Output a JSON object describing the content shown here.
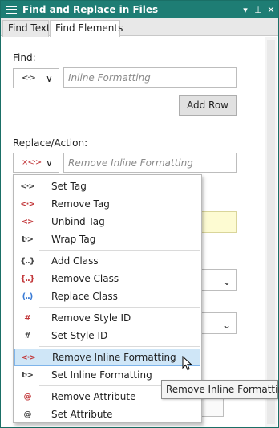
{
  "titlebar": {
    "title": "Find and Replace in Files",
    "dropdown_glyph": "▾",
    "pin_glyph": "⊥",
    "close_glyph": "✕"
  },
  "tabs": [
    {
      "label": "Find Text",
      "active": false
    },
    {
      "label": "Find Elements",
      "active": true
    }
  ],
  "find": {
    "label": "Find:",
    "tag_glyph": "<·>",
    "placeholder": "Inline Formatting",
    "add_row_label": "Add Row"
  },
  "replace": {
    "label": "Replace/Action:",
    "tag_glyph": "×<·>",
    "placeholder": "Remove Inline Formatting"
  },
  "chevron_glyph": "∨",
  "dropdown": {
    "items": [
      {
        "label": "Set Tag",
        "icon": "set-tag-icon",
        "glyph": "<·>",
        "x": false,
        "highlighted": false
      },
      {
        "label": "Remove Tag",
        "icon": "remove-tag-icon",
        "glyph": "<·>",
        "x": true,
        "highlighted": false
      },
      {
        "label": "Unbind Tag",
        "icon": "unbind-tag-icon",
        "glyph": "<>",
        "x": true,
        "highlighted": false
      },
      {
        "label": "Wrap Tag",
        "icon": "wrap-tag-icon",
        "glyph": "t·>",
        "x": false,
        "highlighted": false
      },
      {
        "label": "Add Class",
        "icon": "add-class-icon",
        "glyph": "{..}",
        "x": false,
        "highlighted": false
      },
      {
        "label": "Remove Class",
        "icon": "remove-class-icon",
        "glyph": "{..}",
        "x": true,
        "highlighted": false
      },
      {
        "label": "Replace Class",
        "icon": "replace-class-icon",
        "glyph": "(..)",
        "x": false,
        "highlighted": false
      },
      {
        "label": "Remove Style ID",
        "icon": "remove-style-id-icon",
        "glyph": "#",
        "x": true,
        "highlighted": false
      },
      {
        "label": "Set Style ID",
        "icon": "set-style-id-icon",
        "glyph": "#",
        "x": false,
        "highlighted": false
      },
      {
        "label": "Remove Inline Formatting",
        "icon": "remove-inline-formatting-icon",
        "glyph": "<·>",
        "x": true,
        "highlighted": true
      },
      {
        "label": "Set Inline Formatting",
        "icon": "set-inline-formatting-icon",
        "glyph": "t·>",
        "x": false,
        "highlighted": false
      },
      {
        "label": "Remove Attribute",
        "icon": "remove-attribute-icon",
        "glyph": "@",
        "x": true,
        "highlighted": false
      },
      {
        "label": "Set Attribute",
        "icon": "set-attribute-icon",
        "glyph": "@",
        "x": false,
        "highlighted": false
      }
    ]
  },
  "tooltip": "Remove Inline Formatting",
  "colors": {
    "titlebar": "#1e7d74",
    "highlight": "#cfe6f7",
    "remove_x": "#c2373a"
  }
}
